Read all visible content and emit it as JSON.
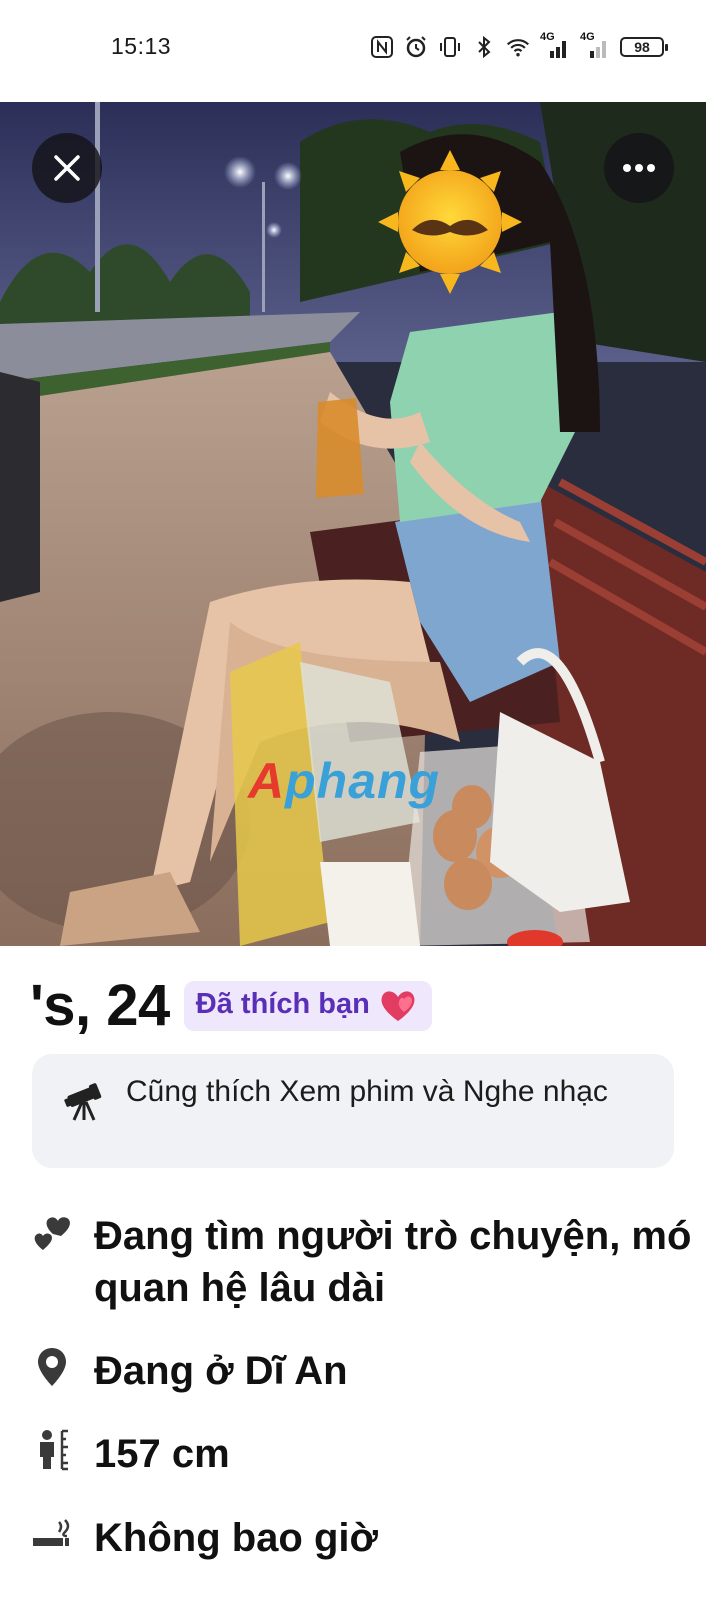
{
  "status_bar": {
    "time": "15:13",
    "battery": "98",
    "network_1": "4G",
    "network_2": "4G",
    "icons": [
      "nfc-icon",
      "alarm-icon",
      "vibrate-icon",
      "bluetooth-icon",
      "wifi-icon",
      "signal-icon",
      "signal-icon",
      "battery-icon"
    ]
  },
  "photo": {
    "close_icon": "close-icon",
    "more_icon": "more-horizontal-icon",
    "watermark_part1": "A",
    "watermark_part2": "phang",
    "face_sticker": "sun-mustache-sticker"
  },
  "profile": {
    "name": "'s, 24",
    "liked_badge": "Đã thích bạn",
    "liked_badge_icon": "heart-emoji-icon",
    "shared_interest": "Cũng thích Xem phim và Nghe nhạc",
    "shared_interest_icon": "telescope-icon",
    "details": [
      {
        "icon": "hearts-icon",
        "text": "Đang tìm người trò chuyện, mối quan hệ lâu dài",
        "line1": "Đang tìm người trò chuyện, mó",
        "line2": "quan hệ lâu dài"
      },
      {
        "icon": "location-pin-icon",
        "text": "Đang ở Dĩ An"
      },
      {
        "icon": "height-icon",
        "text": "157 cm"
      },
      {
        "icon": "smoking-icon",
        "text": "Không bao giờ"
      }
    ]
  },
  "colors": {
    "badge_bg": "#efe7fb",
    "badge_text": "#5a2fb8",
    "card_bg": "#f1f2f5",
    "overlay_button": "#141418"
  }
}
